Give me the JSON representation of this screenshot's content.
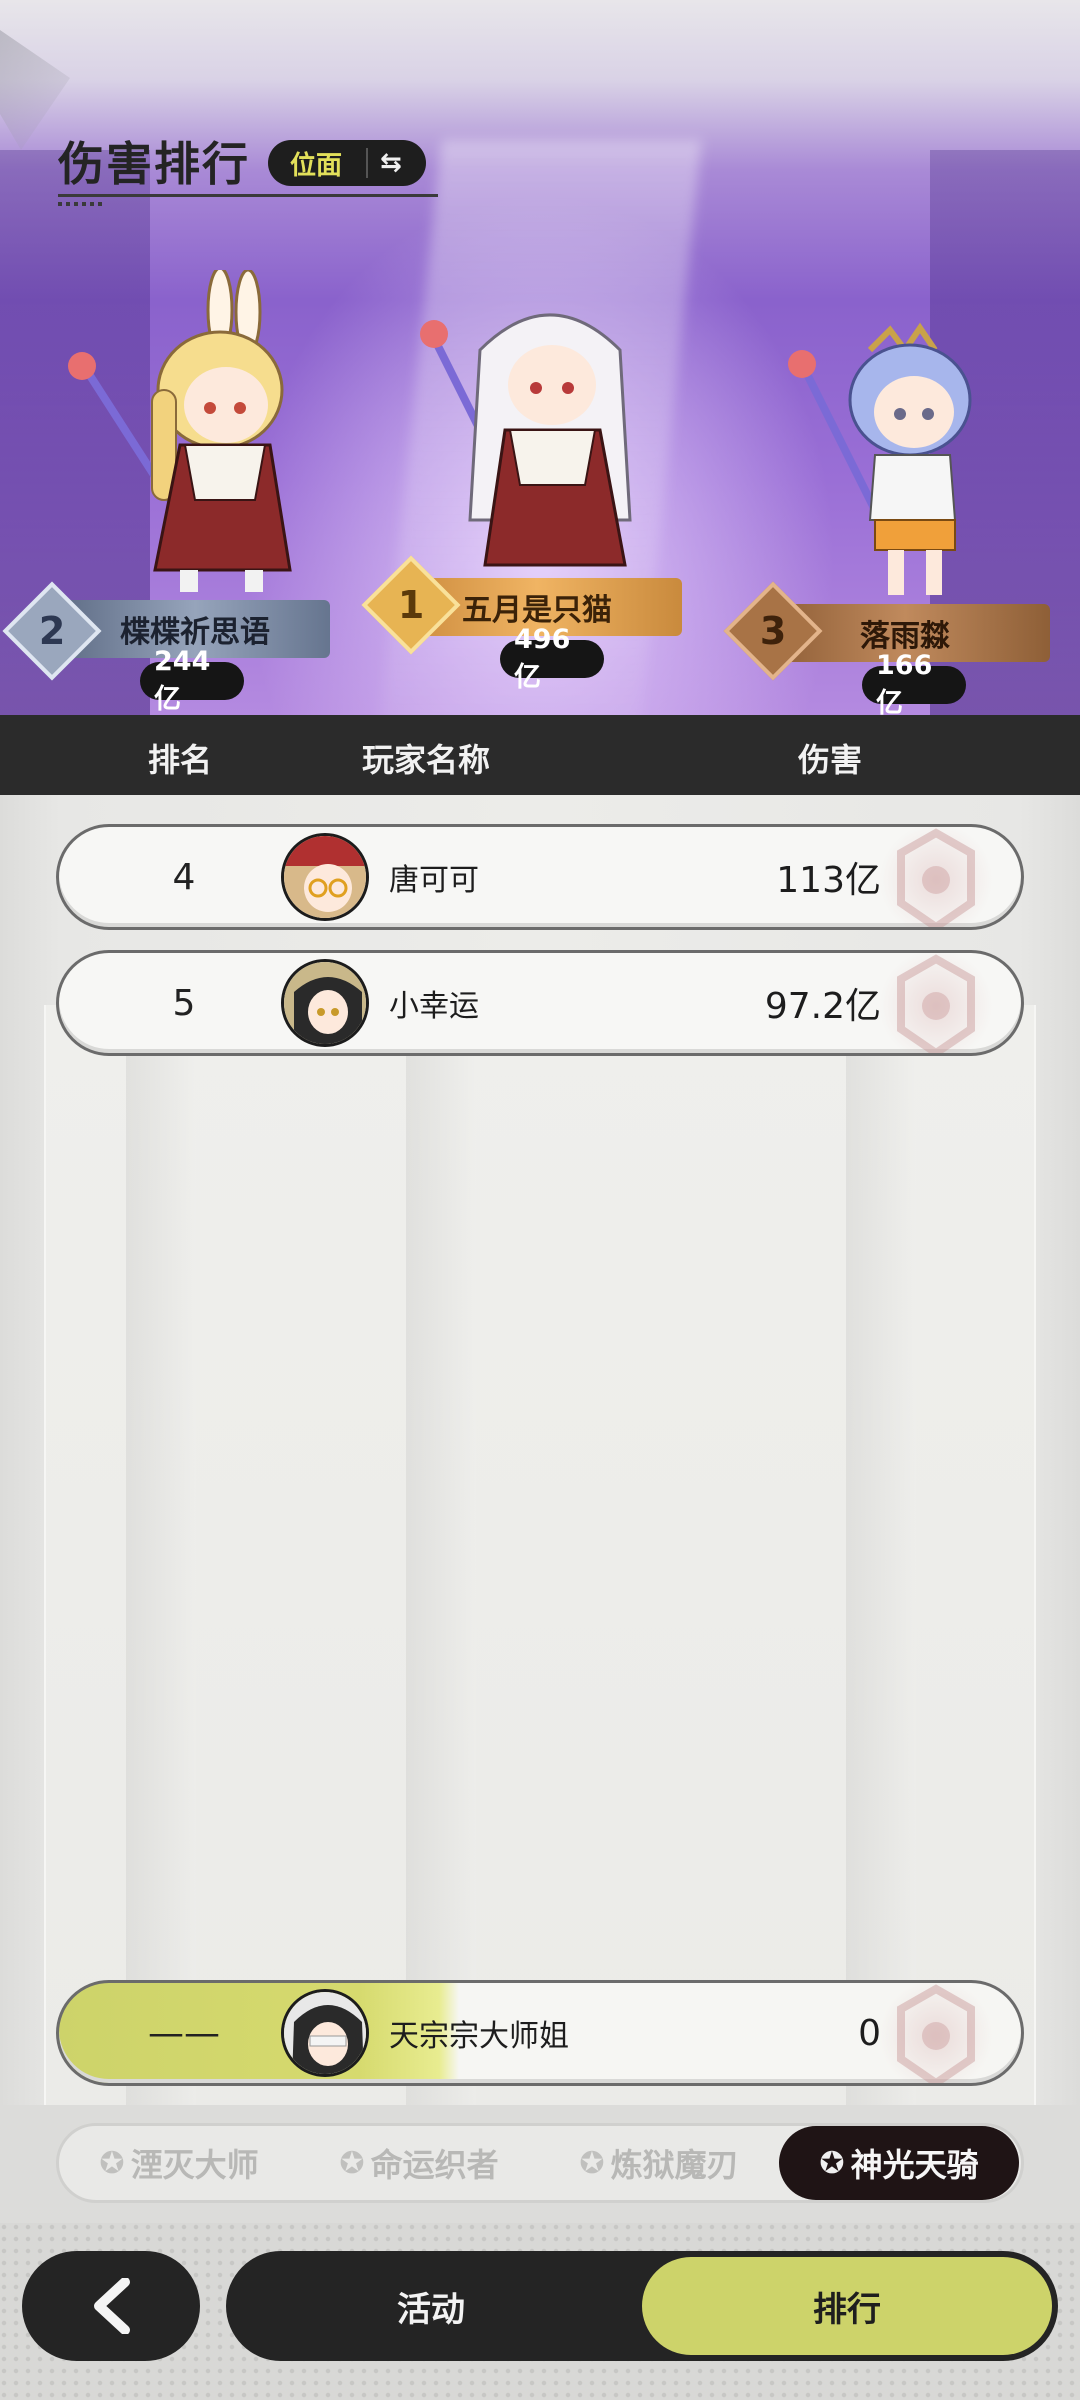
{
  "header": {
    "title": "伤害排行",
    "plane_toggle_label": "位面",
    "plane_toggle_icon": "⇆"
  },
  "podium": [
    {
      "rank": "2",
      "name": "楪楪祈思语",
      "damage": "244亿"
    },
    {
      "rank": "1",
      "name": "五月是只猫",
      "damage": "496亿"
    },
    {
      "rank": "3",
      "name": "落雨㵘",
      "damage": "166亿"
    }
  ],
  "table": {
    "columns": [
      "排名",
      "玩家名称",
      "伤害"
    ],
    "rows": [
      {
        "rank": "4",
        "name": "唐可可",
        "damage": "113亿"
      },
      {
        "rank": "5",
        "name": "小幸运",
        "damage": "97.2亿"
      }
    ]
  },
  "self_row": {
    "rank": "——",
    "name": "天宗宗大师姐",
    "damage": "0"
  },
  "class_tabs": [
    {
      "label": "湮灭大师",
      "icon": "emblem-icon",
      "active": false
    },
    {
      "label": "命运织者",
      "icon": "emblem-icon",
      "active": false
    },
    {
      "label": "炼狱魔刃",
      "icon": "emblem-icon",
      "active": false
    },
    {
      "label": "神光天骑",
      "icon": "emblem-icon",
      "active": true
    }
  ],
  "bottom_nav": {
    "back_icon": "chevron-left-icon",
    "activity_label": "活动",
    "ranking_label": "排行"
  },
  "colors": {
    "accent_lime": "#cdd36a",
    "dark": "#242424"
  }
}
